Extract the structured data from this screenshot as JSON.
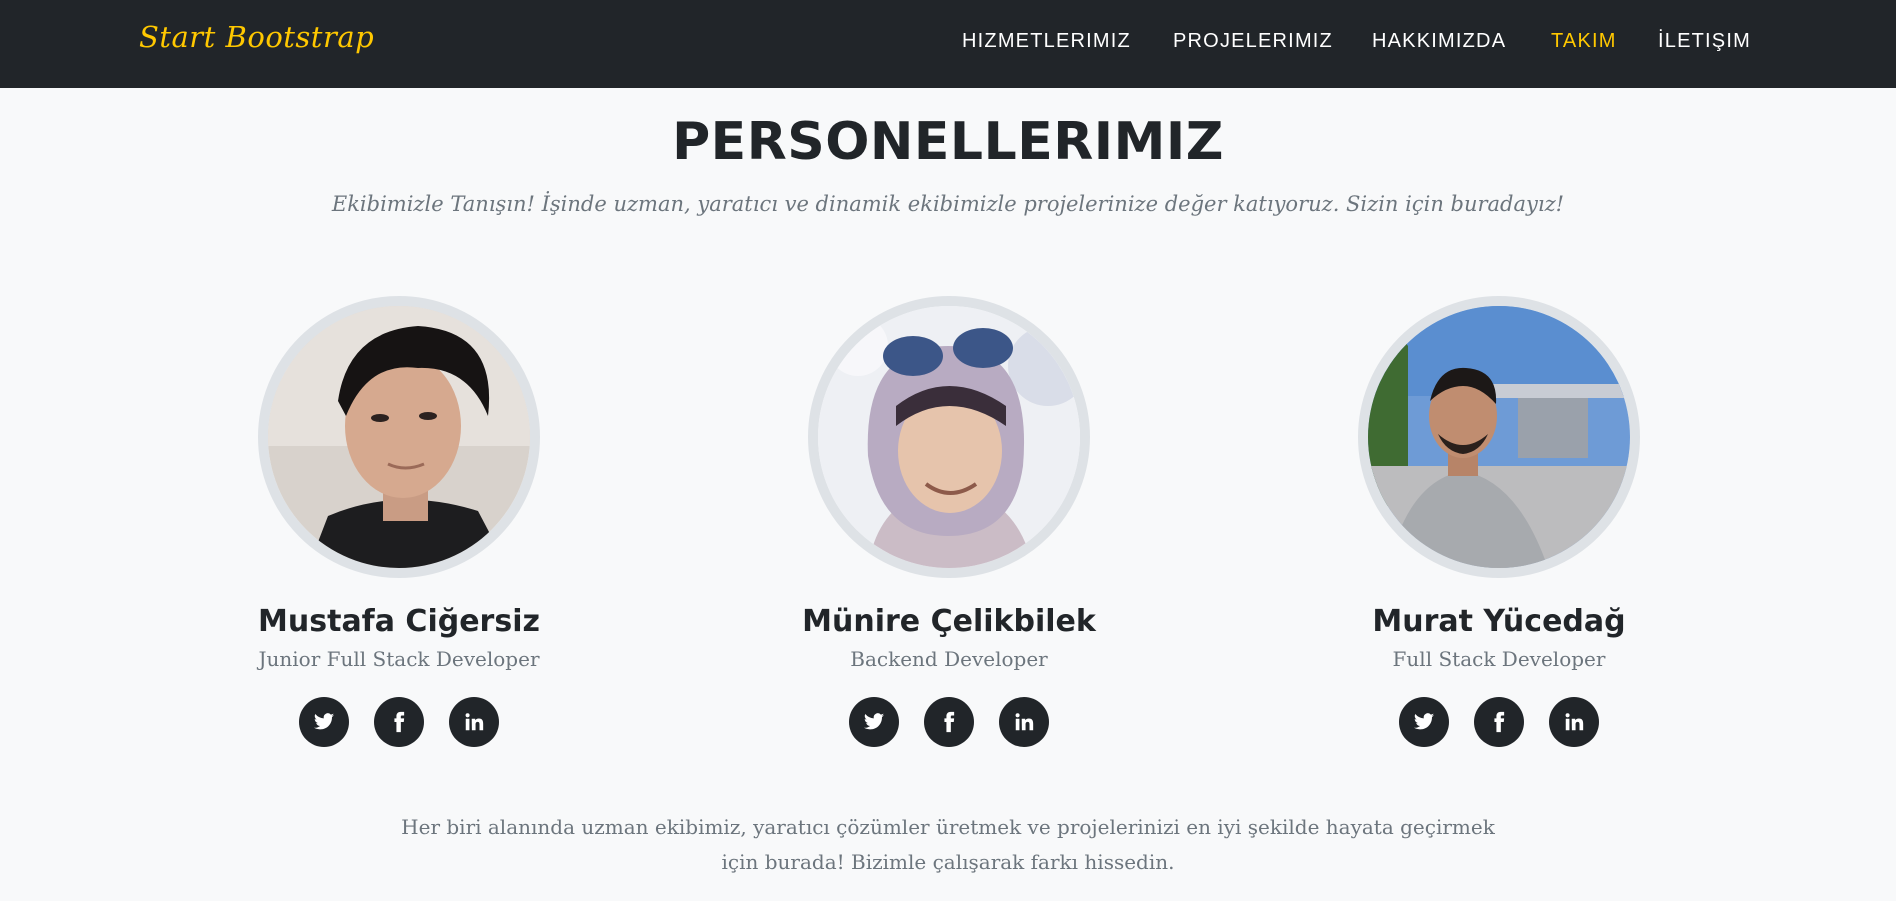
{
  "navbar": {
    "brand": "Start Bootstrap",
    "links": [
      {
        "label": "HIZMETLERIMIZ",
        "active": false
      },
      {
        "label": "PROJELERIMIZ",
        "active": false
      },
      {
        "label": "HAKKIMIZDA",
        "active": false
      },
      {
        "label": "TAKIM",
        "active": true
      },
      {
        "label": "İLETIŞIM",
        "active": false
      }
    ]
  },
  "team": {
    "heading": "PERSONELLERIMIZ",
    "subheading": "Ekibimizle Tanışın! İşinde uzman, yaratıcı ve dinamik ekibimizle projelerinize değer katıyoruz. Sizin için buradayız!",
    "members": [
      {
        "name": "Mustafa Ciğersiz",
        "role": "Junior Full Stack Developer"
      },
      {
        "name": "Münire Çelikbilek",
        "role": "Backend Developer"
      },
      {
        "name": "Murat Yücedağ",
        "role": "Full Stack Developer"
      }
    ],
    "social_icons": [
      "twitter-icon",
      "facebook-icon",
      "linkedin-icon"
    ],
    "footer_line1": "Her biri alanında uzman ekibimiz, yaratıcı çözümler üretmek ve projelerinizi en iyi şekilde hayata geçirmek",
    "footer_line2": "için burada! Bizimle çalışarak farkı hissedin."
  },
  "colors": {
    "accent": "#ffc800",
    "navbar_bg": "#212529",
    "page_bg": "#f8f9fa",
    "muted_text": "#6c757d"
  }
}
